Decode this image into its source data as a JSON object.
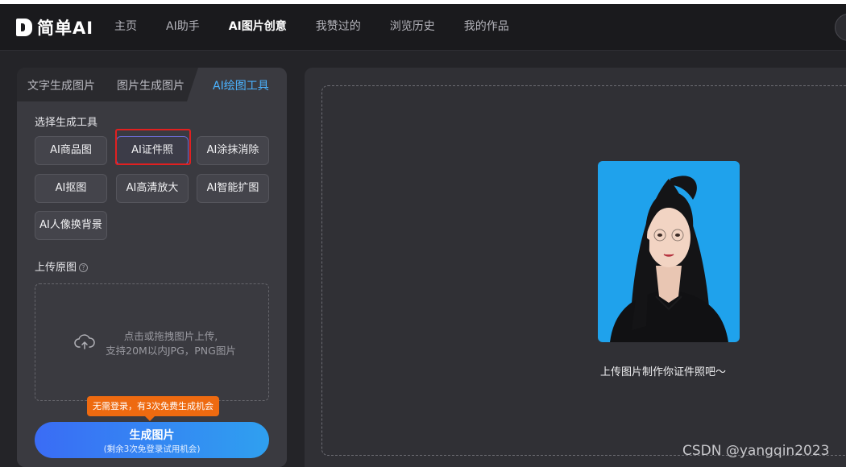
{
  "app": {
    "logo_text": "简单AI"
  },
  "nav": [
    {
      "label": "主页",
      "active": false
    },
    {
      "label": "AI助手",
      "active": false
    },
    {
      "label": "AI图片创意",
      "active": true
    },
    {
      "label": "我赞过的",
      "active": false
    },
    {
      "label": "浏览历史",
      "active": false
    },
    {
      "label": "我的作品",
      "active": false
    }
  ],
  "tabs": [
    {
      "label": "文字生成图片",
      "active": false
    },
    {
      "label": "图片生成图片",
      "active": false
    },
    {
      "label": "AI绘图工具",
      "active": true
    }
  ],
  "tool_section": {
    "title": "选择生成工具",
    "tools": [
      {
        "label": "AI商品图",
        "selected": false
      },
      {
        "label": "AI证件照",
        "selected": true
      },
      {
        "label": "AI涂抹消除",
        "selected": false
      },
      {
        "label": "AI抠图",
        "selected": false
      },
      {
        "label": "AI高清放大",
        "selected": false
      },
      {
        "label": "AI智能扩图",
        "selected": false
      },
      {
        "label": "AI人像换背景",
        "selected": false
      }
    ]
  },
  "upload": {
    "title": "上传原图",
    "help_icon": "?",
    "line1": "点击或拖拽图片上传,",
    "line2": "支持20M以内JPG，PNG图片"
  },
  "promo_badge": "无需登录，有3次免费生成机会",
  "generate": {
    "label": "生成图片",
    "sub": "(剩余3次免登录试用机会)"
  },
  "preview": {
    "caption": "上传图片制作你证件照吧～"
  },
  "watermark": "CSDN @yangqin2023",
  "colors": {
    "accent": "#4bb3ff",
    "highlight": "#e02020",
    "badge": "#ee6a10",
    "photo_bg": "#1fa2ec"
  }
}
